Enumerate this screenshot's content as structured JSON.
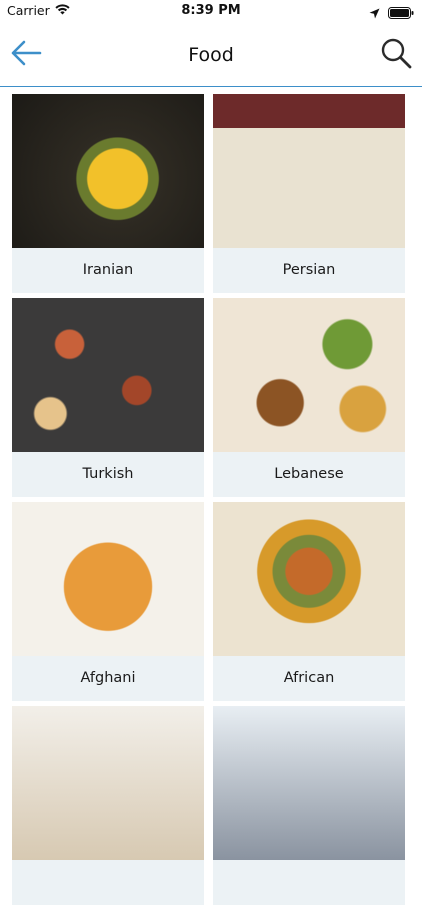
{
  "status_bar": {
    "carrier": "Carrier",
    "time": "8:39 PM",
    "icons": [
      "wifi-icon",
      "location-arrow-icon",
      "battery-icon"
    ]
  },
  "nav": {
    "title": "Food",
    "back_icon": "arrow-left-icon",
    "search_icon": "search-icon"
  },
  "colors": {
    "accent": "#3d8fc9",
    "card_bg": "#ecf2f5"
  },
  "categories": [
    {
      "label": "Iranian"
    },
    {
      "label": "Persian"
    },
    {
      "label": "Turkish"
    },
    {
      "label": "Lebanese"
    },
    {
      "label": "Afghani"
    },
    {
      "label": "African"
    },
    {
      "label": ""
    },
    {
      "label": ""
    }
  ]
}
